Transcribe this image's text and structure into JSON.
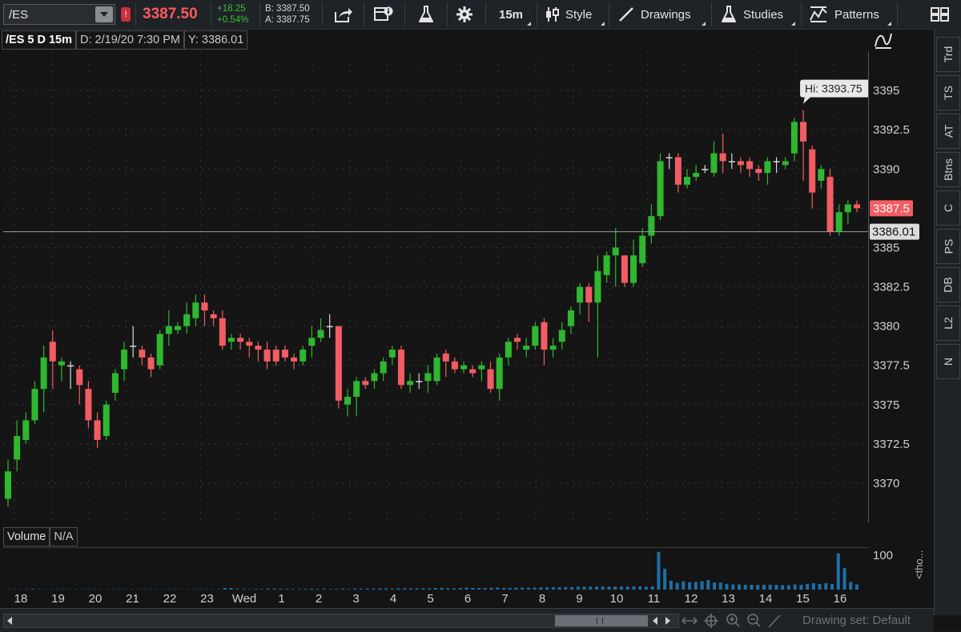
{
  "toolbar": {
    "symbol": "/ES",
    "alert_badge": "!",
    "last_price": "3387.50",
    "net_change": "+18.25",
    "net_change_pct": "+0.54%",
    "bid": "B: 3387.50",
    "ask": "A: 3387.75",
    "aggregation": "15m",
    "style_label": "Style",
    "drawings_label": "Drawings",
    "studies_label": "Studies",
    "patterns_label": "Patterns"
  },
  "chart_header": {
    "symbol_period": "/ES 5 D 15m",
    "date": "D: 2/19/20 7:30 PM",
    "y_value": "Y: 3386.01"
  },
  "right_tabs": [
    "Trd",
    "TS",
    "AT",
    "Btns",
    "C",
    "PS",
    "DB",
    "L2",
    "N"
  ],
  "volume_header": {
    "label": "Volume",
    "value": "N/A"
  },
  "volume_axis": {
    "label": "100",
    "unit": "<tho..."
  },
  "bottom_bar": {
    "drawing_set": "Drawing set: Default"
  },
  "colors": {
    "up": "#2fb72f",
    "down": "#f25c63",
    "bg": "#151515",
    "volume": "#1e6fa6"
  },
  "chart_data": {
    "type": "candlestick",
    "y_ticks": [
      "3395",
      "3392.5",
      "3390",
      "3387.5",
      "3385",
      "3382.5",
      "3380",
      "3377.5",
      "3375",
      "3372.5",
      "3370"
    ],
    "y_range": [
      3367.5,
      3397.5
    ],
    "x_labels": [
      "18",
      "19",
      "20",
      "21",
      "22",
      "23",
      "Wed",
      "1",
      "2",
      "3",
      "4",
      "5",
      "6",
      "7",
      "8",
      "9",
      "10",
      "11",
      "12",
      "13",
      "14",
      "15",
      "16"
    ],
    "hi_label": "Hi: 3393.75",
    "hi_value": 3393.75,
    "last_label": "3387.5",
    "last_value": 3387.5,
    "crosshair_label": "3386.01",
    "crosshair_value": 3386.01,
    "candles": [
      [
        3369.0,
        3370.75,
        3368.5,
        3371.5
      ],
      [
        3371.5,
        3373.0,
        3370.75,
        3374.0
      ],
      [
        3372.75,
        3374.0,
        3372.5,
        3374.5
      ],
      [
        3374.0,
        3376.0,
        3373.75,
        3376.5
      ],
      [
        3376.0,
        3378.0,
        3374.5,
        3378.75
      ],
      [
        3379.0,
        3377.75,
        3376.0,
        3379.75
      ],
      [
        3377.5,
        3377.75,
        3376.5,
        3378.0
      ],
      [
        3377.5,
        3377.5,
        3376.0,
        3377.75
      ],
      [
        3377.25,
        3376.25,
        3375.0,
        3377.5
      ],
      [
        3376.0,
        3374.0,
        3373.5,
        3376.5
      ],
      [
        3374.0,
        3372.75,
        3372.25,
        3374.5
      ],
      [
        3373.0,
        3375.0,
        3372.75,
        3375.25
      ],
      [
        3375.75,
        3377.0,
        3375.25,
        3377.25
      ],
      [
        3377.25,
        3378.5,
        3376.5,
        3379.0
      ],
      [
        3378.75,
        3378.75,
        3378.0,
        3380.0
      ],
      [
        3378.5,
        3378.0,
        3377.5,
        3378.75
      ],
      [
        3378.0,
        3377.25,
        3376.75,
        3378.25
      ],
      [
        3377.5,
        3379.5,
        3377.25,
        3379.75
      ],
      [
        3379.5,
        3380.0,
        3378.75,
        3381.0
      ],
      [
        3379.75,
        3380.0,
        3379.5,
        3380.25
      ],
      [
        3380.0,
        3380.75,
        3379.5,
        3381.5
      ],
      [
        3380.5,
        3381.5,
        3380.0,
        3382.0
      ],
      [
        3381.5,
        3381.0,
        3380.0,
        3382.0
      ],
      [
        3380.75,
        3380.5,
        3380.0,
        3381.0
      ],
      [
        3380.5,
        3378.75,
        3378.5,
        3381.0
      ],
      [
        3379.0,
        3379.25,
        3378.5,
        3379.5
      ],
      [
        3379.25,
        3379.0,
        3378.5,
        3379.5
      ],
      [
        3379.0,
        3378.75,
        3378.0,
        3379.25
      ],
      [
        3378.75,
        3378.5,
        3377.75,
        3379.0
      ],
      [
        3378.5,
        3377.75,
        3377.25,
        3379.0
      ],
      [
        3378.5,
        3377.75,
        3377.5,
        3378.75
      ],
      [
        3378.5,
        3378.0,
        3377.75,
        3378.75
      ],
      [
        3378.0,
        3377.75,
        3377.25,
        3378.25
      ],
      [
        3377.75,
        3378.5,
        3377.5,
        3378.75
      ],
      [
        3378.75,
        3379.25,
        3378.0,
        3380.0
      ],
      [
        3379.25,
        3379.75,
        3379.0,
        3380.5
      ],
      [
        3380.0,
        3380.0,
        3379.25,
        3380.75
      ],
      [
        3380.0,
        3375.25,
        3374.75,
        3380.0
      ],
      [
        3375.0,
        3375.5,
        3374.25,
        3376.0
      ],
      [
        3375.5,
        3376.5,
        3374.25,
        3376.75
      ],
      [
        3376.5,
        3376.25,
        3376.0,
        3376.75
      ],
      [
        3376.5,
        3377.0,
        3376.0,
        3377.25
      ],
      [
        3377.0,
        3377.75,
        3376.5,
        3378.0
      ],
      [
        3378.0,
        3378.5,
        3377.5,
        3378.75
      ],
      [
        3378.5,
        3376.25,
        3376.0,
        3378.75
      ],
      [
        3376.25,
        3376.5,
        3375.75,
        3377.0
      ],
      [
        3376.5,
        3376.5,
        3376.0,
        3377.0
      ],
      [
        3376.5,
        3377.0,
        3375.75,
        3377.5
      ],
      [
        3376.5,
        3378.0,
        3376.25,
        3378.25
      ],
      [
        3378.25,
        3377.75,
        3376.75,
        3378.5
      ],
      [
        3377.75,
        3377.25,
        3377.0,
        3378.0
      ],
      [
        3377.25,
        3377.5,
        3377.0,
        3377.75
      ],
      [
        3377.25,
        3377.0,
        3376.75,
        3377.5
      ],
      [
        3377.25,
        3377.5,
        3376.5,
        3377.75
      ],
      [
        3377.25,
        3376.0,
        3375.75,
        3377.75
      ],
      [
        3376.0,
        3378.0,
        3375.25,
        3378.25
      ],
      [
        3378.0,
        3379.0,
        3377.5,
        3379.25
      ],
      [
        3379.25,
        3379.0,
        3378.5,
        3379.5
      ],
      [
        3378.5,
        3378.75,
        3378.0,
        3379.25
      ],
      [
        3378.75,
        3380.0,
        3378.5,
        3380.25
      ],
      [
        3380.25,
        3378.5,
        3377.5,
        3380.5
      ],
      [
        3378.5,
        3378.75,
        3378.0,
        3379.25
      ],
      [
        3379.0,
        3379.75,
        3378.5,
        3380.25
      ],
      [
        3380.0,
        3381.0,
        3379.5,
        3381.25
      ],
      [
        3381.5,
        3382.5,
        3380.75,
        3382.75
      ],
      [
        3382.5,
        3381.5,
        3380.25,
        3382.75
      ],
      [
        3381.5,
        3383.5,
        3378.0,
        3384.5
      ],
      [
        3383.25,
        3384.5,
        3382.75,
        3384.75
      ],
      [
        3384.5,
        3385.0,
        3382.5,
        3386.25
      ],
      [
        3384.5,
        3382.75,
        3382.5,
        3384.5
      ],
      [
        3382.75,
        3384.5,
        3382.5,
        3385.5
      ],
      [
        3384.0,
        3385.75,
        3383.75,
        3386.25
      ],
      [
        3385.75,
        3387.0,
        3385.25,
        3387.75
      ],
      [
        3387.0,
        3390.5,
        3386.75,
        3391.0
      ],
      [
        3390.75,
        3390.75,
        3390.0,
        3391.0
      ],
      [
        3390.75,
        3389.0,
        3388.5,
        3391.0
      ],
      [
        3389.0,
        3389.5,
        3388.75,
        3390.0
      ],
      [
        3389.5,
        3389.75,
        3389.25,
        3390.25
      ],
      [
        3390.0,
        3390.0,
        3389.75,
        3390.25
      ],
      [
        3389.75,
        3391.0,
        3389.5,
        3391.75
      ],
      [
        3391.0,
        3390.5,
        3389.75,
        3392.25
      ],
      [
        3390.5,
        3390.5,
        3390.0,
        3391.0
      ],
      [
        3390.5,
        3390.25,
        3389.75,
        3390.75
      ],
      [
        3390.5,
        3390.0,
        3389.5,
        3390.75
      ],
      [
        3390.0,
        3389.75,
        3389.25,
        3390.25
      ],
      [
        3389.75,
        3390.5,
        3389.0,
        3390.75
      ],
      [
        3390.5,
        3390.5,
        3389.75,
        3390.75
      ],
      [
        3390.25,
        3390.5,
        3390.0,
        3390.75
      ],
      [
        3391.0,
        3393.0,
        3390.5,
        3393.25
      ],
      [
        3393.0,
        3391.75,
        3389.25,
        3393.75
      ],
      [
        3391.25,
        3388.5,
        3387.5,
        3391.5
      ],
      [
        3389.25,
        3390.0,
        3388.75,
        3390.25
      ],
      [
        3389.5,
        3386.0,
        3385.75,
        3390.0
      ],
      [
        3386.0,
        3387.25,
        3385.75,
        3387.75
      ],
      [
        3387.25,
        3387.75,
        3386.5,
        3388.0
      ],
      [
        3387.75,
        3387.5,
        3387.25,
        3388.0
      ]
    ],
    "volume": [
      1,
      1,
      1,
      1,
      2,
      1,
      1,
      1,
      1,
      1,
      1,
      1,
      1,
      1,
      1,
      1,
      1,
      1,
      1,
      1,
      1,
      1,
      1,
      1,
      1,
      1,
      1,
      1,
      1,
      1,
      1,
      1,
      1,
      1,
      1,
      5,
      5,
      2,
      2,
      1,
      2,
      2,
      3,
      3,
      2,
      2,
      2,
      2,
      2,
      3,
      2,
      3,
      2,
      2,
      3,
      2,
      3,
      3,
      3,
      3,
      4,
      4,
      3,
      4,
      4,
      4,
      4,
      4,
      4,
      5,
      5,
      4,
      4,
      5,
      6,
      5,
      5,
      5,
      6,
      6,
      5,
      5,
      6,
      6,
      6,
      6,
      7,
      7,
      7,
      7,
      8,
      8,
      9,
      9,
      9,
      9,
      9,
      9,
      9,
      9,
      9,
      10,
      10,
      9,
      10,
      118,
      65,
      28,
      21,
      26,
      23,
      24,
      26,
      30,
      22,
      22,
      18,
      16,
      16,
      15,
      15,
      15,
      15,
      15,
      15,
      14,
      14,
      16,
      15,
      18,
      20,
      18,
      20,
      18,
      113,
      67,
      24,
      16
    ],
    "volume_max": 130
  }
}
